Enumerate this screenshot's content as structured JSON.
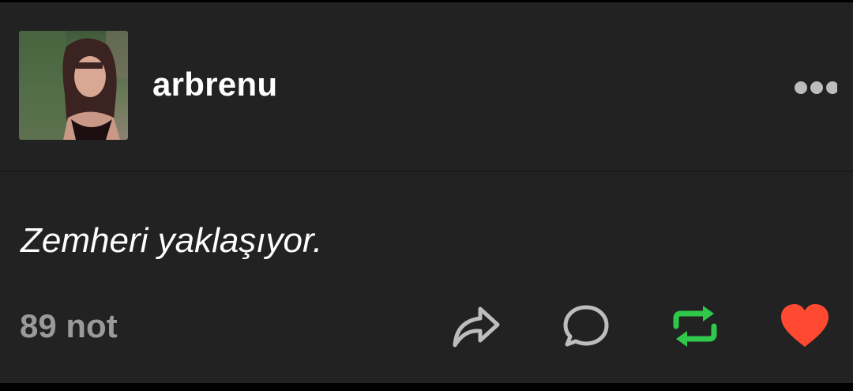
{
  "post": {
    "username": "arbrenu",
    "text": "Zemheri yaklaşıyor.",
    "notes_label": "89 not",
    "avatar_icon": "profile-photo",
    "more_icon": "ellipsis-icon"
  },
  "actions": {
    "share_icon": "share-arrow-icon",
    "reply_icon": "speech-bubble-icon",
    "reblog_icon": "reblog-icon",
    "like_icon": "heart-icon"
  },
  "colors": {
    "background": "#222222",
    "text": "#ffffff",
    "muted": "#9a9a9a",
    "reblog_active": "#2fc84b",
    "like_active": "#ff4930"
  }
}
